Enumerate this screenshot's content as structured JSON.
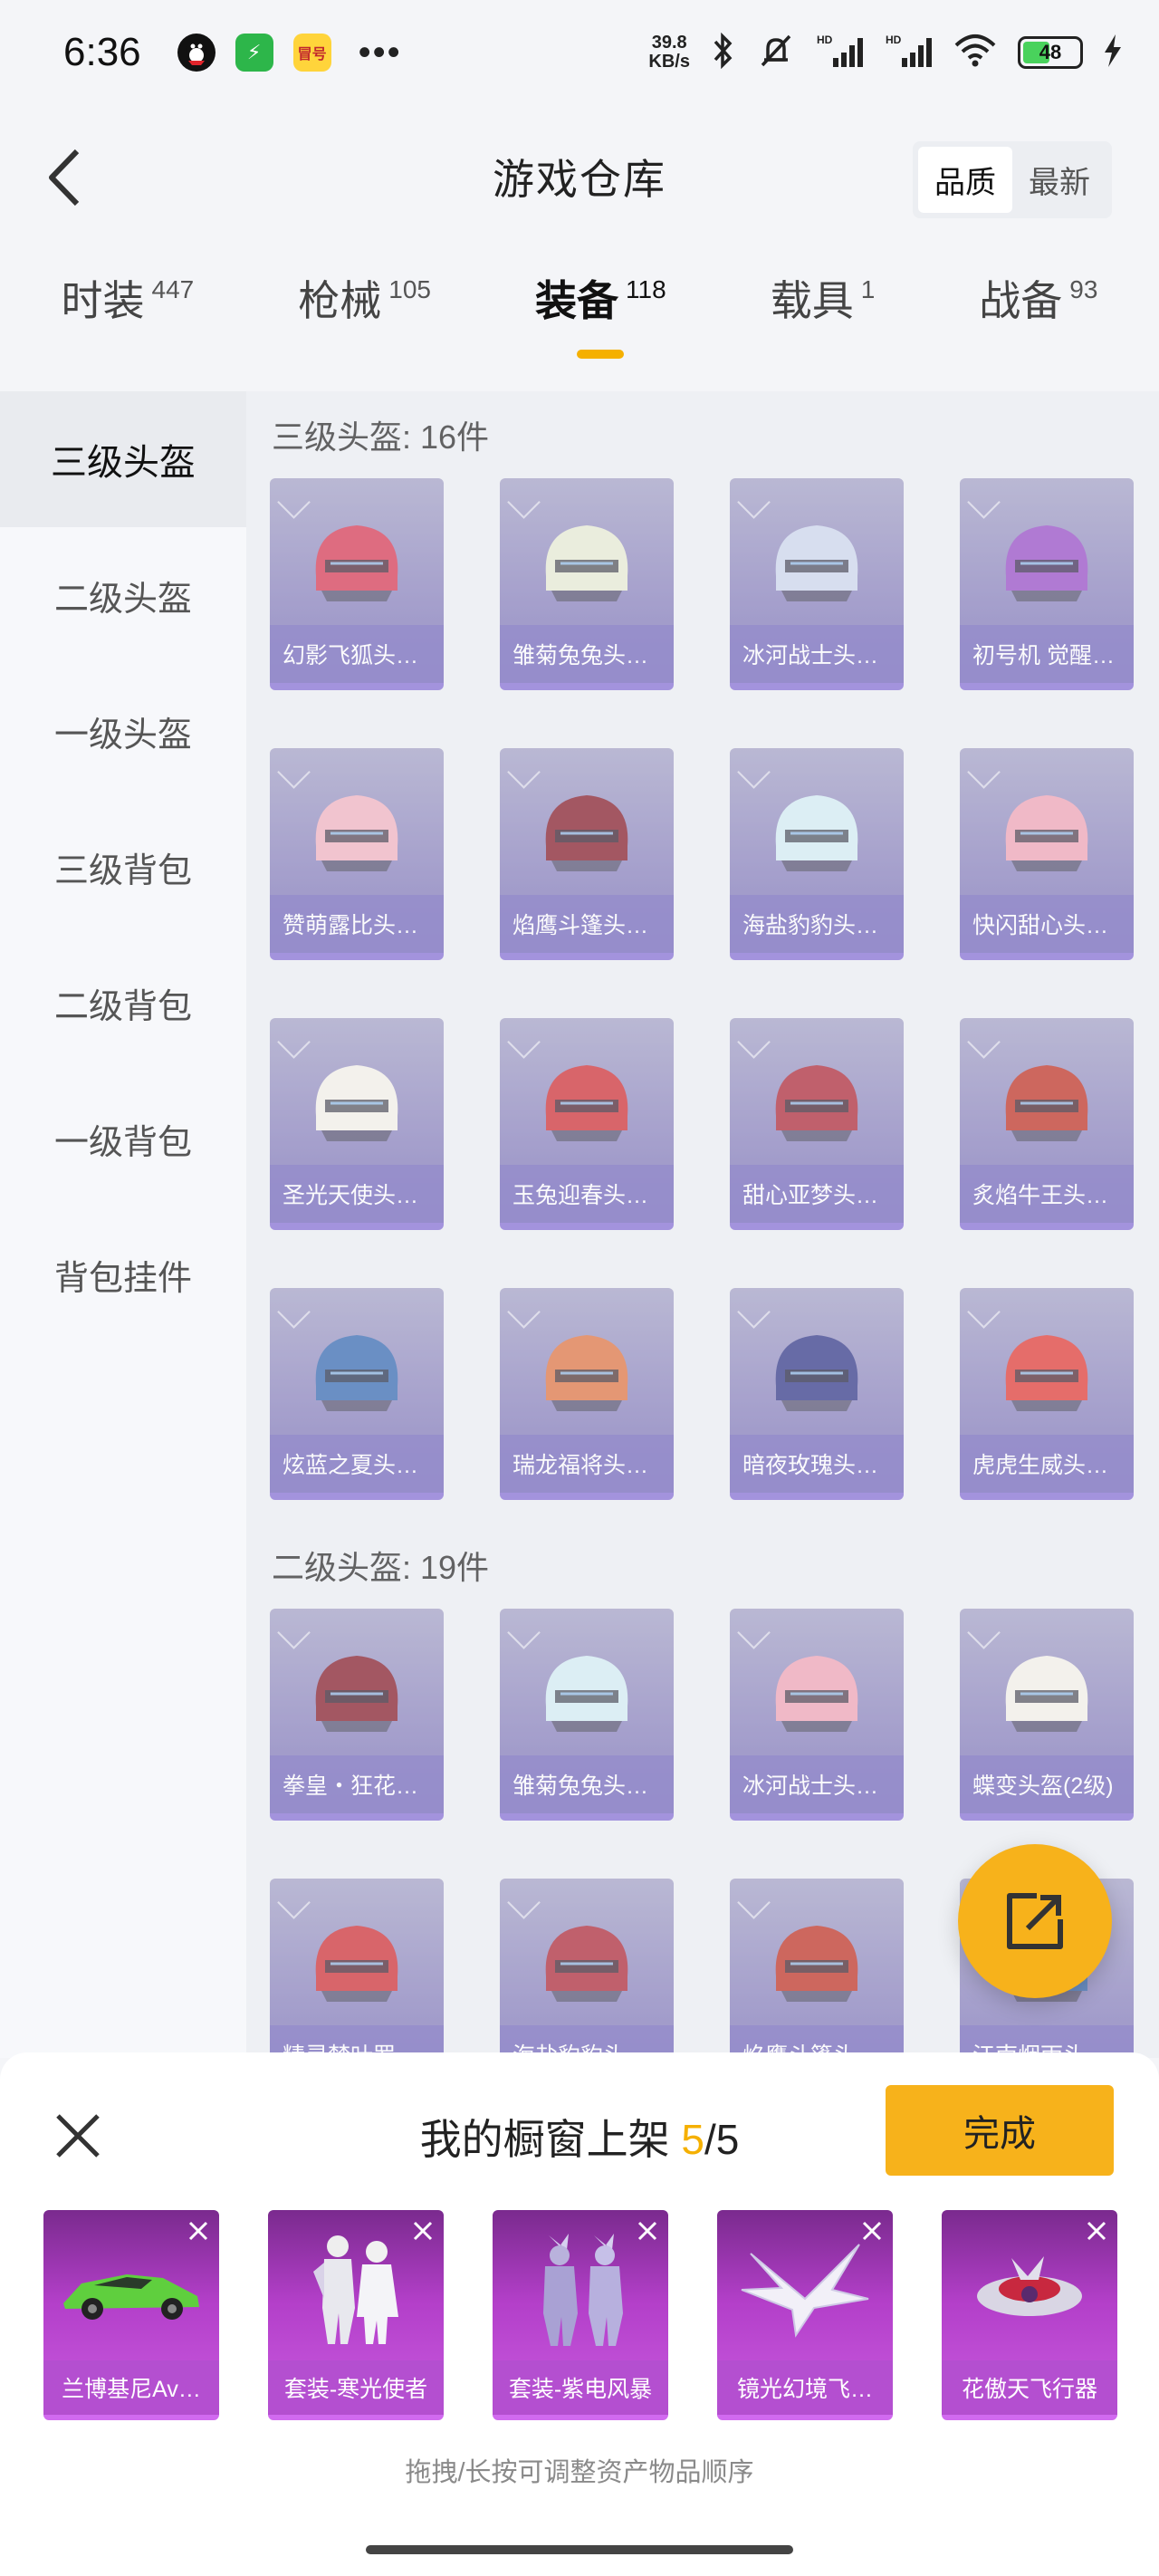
{
  "status_bar": {
    "time": "6:36",
    "apps": [
      {
        "icon": "qq-app-icon"
      },
      {
        "icon": "green-app-icon",
        "glyph": "⚡"
      },
      {
        "icon": "yellow-app-icon",
        "glyph": "冒号"
      }
    ],
    "more": "•••",
    "net_speed_value": "39.8",
    "net_speed_unit": "KB/s",
    "battery": "48",
    "battery_level": 0.48
  },
  "header": {
    "title": "游戏仓库",
    "sort_options": [
      "品质",
      "最新"
    ]
  },
  "category_tabs": [
    {
      "label": "时装",
      "count": "447"
    },
    {
      "label": "枪械",
      "count": "105"
    },
    {
      "label": "装备",
      "count": "118"
    },
    {
      "label": "载具",
      "count": "1"
    },
    {
      "label": "战备",
      "count": "93"
    }
  ],
  "sidebar": {
    "items": [
      "三级头盔",
      "二级头盔",
      "一级头盔",
      "三级背包",
      "二级背包",
      "一级背包",
      "背包挂件"
    ]
  },
  "sections": [
    {
      "title": "三级头盔: 16件",
      "items": [
        "幻影飞狐头…",
        "雏菊兔兔头…",
        "冰河战士头…",
        "初号机 觉醒…",
        "赞萌露比头…",
        "焰鹰斗篷头…",
        "海盐豹豹头…",
        "快闪甜心头…",
        "圣光天使头…",
        "玉兔迎春头…",
        "甜心亚梦头…",
        "炙焰牛王头…",
        "炫蓝之夏头…",
        "瑞龙福将头…",
        "暗夜玫瑰头…",
        "虎虎生威头…"
      ]
    },
    {
      "title": "二级头盔: 19件",
      "items": [
        "拳皇・狂花…",
        "雏菊兔兔头…",
        "冰河战士头…",
        "蝶变头盔(2级)",
        "精灵梦叶罗…",
        "海盐豹豹头…",
        "焰鹰斗篷头…",
        "江南烟雨头…"
      ]
    }
  ],
  "sheet": {
    "title_prefix": "我的橱窗上架 ",
    "count_current": "5",
    "count_total": "/5",
    "done_label": "完成",
    "showcase": [
      "兰博基尼Av…",
      "套装-寒光使者",
      "套装-紫电风暴",
      "镜光幻境飞…",
      "花傲天飞行器"
    ],
    "hint": "拖拽/长按可调整资产物品顺序"
  },
  "colors": {
    "accent": "#f7b21b",
    "card_epic": "#8a74d6",
    "card_legend": "#b44fd0"
  }
}
